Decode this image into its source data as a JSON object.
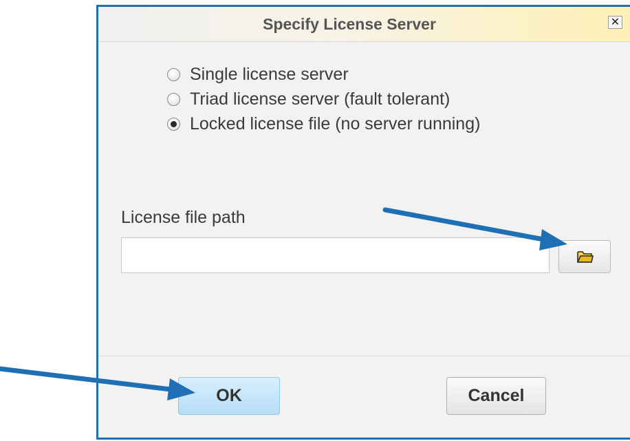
{
  "dialog": {
    "title": "Specify License Server",
    "close_symbol": "✕"
  },
  "options": [
    {
      "label": "Single license server",
      "selected": false
    },
    {
      "label": "Triad license server (fault tolerant)",
      "selected": false
    },
    {
      "label": "Locked license file (no server running)",
      "selected": true
    }
  ],
  "license_file": {
    "label": "License file path",
    "value": "",
    "browse_icon": "folder-icon"
  },
  "buttons": {
    "ok_label": "OK",
    "cancel_label": "Cancel"
  },
  "colors": {
    "accent_border": "#1f6fb4",
    "annotation_arrow": "#1f6fb4",
    "ok_button": "#b5ddf7",
    "title_gradient_end": "#fff0b4"
  }
}
